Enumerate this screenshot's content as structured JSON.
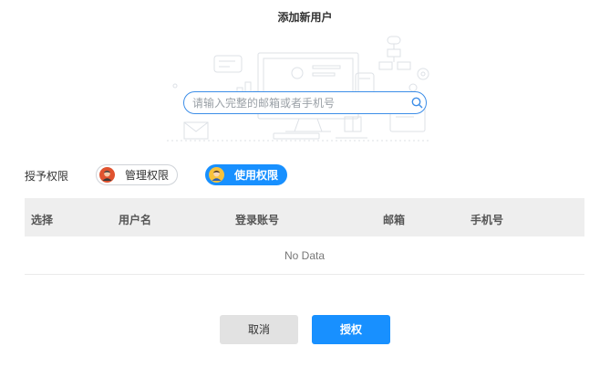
{
  "dialog": {
    "title": "添加新用户"
  },
  "search": {
    "placeholder": "请输入完整的邮箱或者手机号",
    "value": ""
  },
  "permission": {
    "label": "授予权限",
    "options": [
      {
        "label": "管理权限",
        "selected": false,
        "icon": "admin-avatar-icon"
      },
      {
        "label": "使用权限",
        "selected": true,
        "icon": "user-avatar-icon"
      }
    ]
  },
  "table": {
    "columns": [
      "选择",
      "用户名",
      "登录账号",
      "邮箱",
      "手机号"
    ],
    "rows": [],
    "empty_text": "No Data"
  },
  "actions": {
    "cancel_label": "取消",
    "confirm_label": "授权"
  },
  "colors": {
    "accent": "#1890ff",
    "header_bg": "#eeeeee",
    "cancel_bg": "#e2e2e2"
  }
}
